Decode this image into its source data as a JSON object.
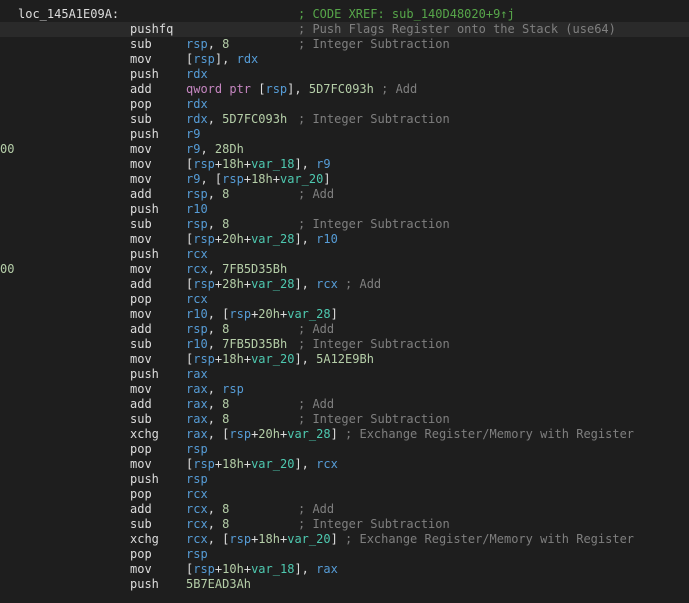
{
  "colors": {
    "background": "#1e1e1e",
    "highlight_line": "#2a2a2a",
    "register": "#569cd6",
    "number": "#b5cea8",
    "variable": "#4ec9b0",
    "keyword": "#c586c0",
    "comment": "#7f7f7f",
    "xref": "#57a64a",
    "text": "#dcdcdc"
  },
  "label": "loc_145A1E09A:",
  "xref_comment": "; CODE XREF: sub_140D48020+9↑j",
  "instructions": [
    {
      "mn": "pushfq",
      "ops": [],
      "comment": "; Push Flags Register onto the Stack (use64)",
      "sel": true
    },
    {
      "mn": "sub",
      "ops": [
        [
          "rsp",
          "r"
        ],
        [
          ", ",
          "p"
        ],
        [
          "8",
          "n"
        ]
      ],
      "comment": "; Integer Subtraction"
    },
    {
      "mn": "mov",
      "ops": [
        [
          "[",
          "p"
        ],
        [
          "rsp",
          "r"
        ],
        [
          "], ",
          "p"
        ],
        [
          "rdx",
          "r"
        ]
      ]
    },
    {
      "mn": "push",
      "ops": [
        [
          "rdx",
          "r"
        ]
      ]
    },
    {
      "mn": "add",
      "ops": [
        [
          "qword ptr ",
          "k"
        ],
        [
          "[",
          "p"
        ],
        [
          "rsp",
          "r"
        ],
        [
          "], ",
          "p"
        ],
        [
          "5D7FC093h",
          "n"
        ],
        [
          " ; Add",
          "c"
        ]
      ]
    },
    {
      "mn": "pop",
      "ops": [
        [
          "rdx",
          "r"
        ]
      ]
    },
    {
      "mn": "sub",
      "ops": [
        [
          "rdx",
          "r"
        ],
        [
          ", ",
          "p"
        ],
        [
          "5D7FC093h",
          "n"
        ]
      ],
      "comment": "; Integer Subtraction"
    },
    {
      "mn": "push",
      "ops": [
        [
          "r9",
          "r"
        ]
      ]
    },
    {
      "prefix": "00",
      "mn": "mov",
      "ops": [
        [
          "r9",
          "r"
        ],
        [
          ", ",
          "p"
        ],
        [
          "28Dh",
          "n"
        ]
      ]
    },
    {
      "mn": "mov",
      "ops": [
        [
          "[",
          "p"
        ],
        [
          "rsp",
          "r"
        ],
        [
          "+",
          "p"
        ],
        [
          "18h",
          "n"
        ],
        [
          "+",
          "p"
        ],
        [
          "var_18",
          "v"
        ],
        [
          "], ",
          "p"
        ],
        [
          "r9",
          "r"
        ]
      ]
    },
    {
      "mn": "mov",
      "ops": [
        [
          "r9",
          "r"
        ],
        [
          ", [",
          "p"
        ],
        [
          "rsp",
          "r"
        ],
        [
          "+",
          "p"
        ],
        [
          "18h",
          "n"
        ],
        [
          "+",
          "p"
        ],
        [
          "var_20",
          "v"
        ],
        [
          "]",
          "p"
        ]
      ]
    },
    {
      "mn": "add",
      "ops": [
        [
          "rsp",
          "r"
        ],
        [
          ", ",
          "p"
        ],
        [
          "8",
          "n"
        ]
      ],
      "comment": "; Add"
    },
    {
      "mn": "push",
      "ops": [
        [
          "r10",
          "r"
        ]
      ]
    },
    {
      "mn": "sub",
      "ops": [
        [
          "rsp",
          "r"
        ],
        [
          ", ",
          "p"
        ],
        [
          "8",
          "n"
        ]
      ],
      "comment": "; Integer Subtraction"
    },
    {
      "mn": "mov",
      "ops": [
        [
          "[",
          "p"
        ],
        [
          "rsp",
          "r"
        ],
        [
          "+",
          "p"
        ],
        [
          "20h",
          "n"
        ],
        [
          "+",
          "p"
        ],
        [
          "var_28",
          "v"
        ],
        [
          "], ",
          "p"
        ],
        [
          "r10",
          "r"
        ]
      ]
    },
    {
      "mn": "push",
      "ops": [
        [
          "rcx",
          "r"
        ]
      ]
    },
    {
      "prefix": "00",
      "mn": "mov",
      "ops": [
        [
          "rcx",
          "r"
        ],
        [
          ", ",
          "p"
        ],
        [
          "7FB5D35Bh",
          "n"
        ]
      ]
    },
    {
      "mn": "add",
      "ops": [
        [
          "[",
          "p"
        ],
        [
          "rsp",
          "r"
        ],
        [
          "+",
          "p"
        ],
        [
          "28h",
          "n"
        ],
        [
          "+",
          "p"
        ],
        [
          "var_28",
          "v"
        ],
        [
          "], ",
          "p"
        ],
        [
          "rcx",
          "r"
        ],
        [
          " ; Add",
          "c"
        ]
      ]
    },
    {
      "mn": "pop",
      "ops": [
        [
          "rcx",
          "r"
        ]
      ]
    },
    {
      "mn": "mov",
      "ops": [
        [
          "r10",
          "r"
        ],
        [
          ", [",
          "p"
        ],
        [
          "rsp",
          "r"
        ],
        [
          "+",
          "p"
        ],
        [
          "20h",
          "n"
        ],
        [
          "+",
          "p"
        ],
        [
          "var_28",
          "v"
        ],
        [
          "]",
          "p"
        ]
      ]
    },
    {
      "mn": "add",
      "ops": [
        [
          "rsp",
          "r"
        ],
        [
          ", ",
          "p"
        ],
        [
          "8",
          "n"
        ]
      ],
      "comment": "; Add"
    },
    {
      "mn": "sub",
      "ops": [
        [
          "r10",
          "r"
        ],
        [
          ", ",
          "p"
        ],
        [
          "7FB5D35Bh",
          "n"
        ]
      ],
      "comment": "; Integer Subtraction"
    },
    {
      "mn": "mov",
      "ops": [
        [
          "[",
          "p"
        ],
        [
          "rsp",
          "r"
        ],
        [
          "+",
          "p"
        ],
        [
          "18h",
          "n"
        ],
        [
          "+",
          "p"
        ],
        [
          "var_20",
          "v"
        ],
        [
          "], ",
          "p"
        ],
        [
          "5A12E9Bh",
          "n"
        ]
      ]
    },
    {
      "mn": "push",
      "ops": [
        [
          "rax",
          "r"
        ]
      ]
    },
    {
      "mn": "mov",
      "ops": [
        [
          "rax",
          "r"
        ],
        [
          ", ",
          "p"
        ],
        [
          "rsp",
          "r"
        ]
      ]
    },
    {
      "mn": "add",
      "ops": [
        [
          "rax",
          "r"
        ],
        [
          ", ",
          "p"
        ],
        [
          "8",
          "n"
        ]
      ],
      "comment": "; Add"
    },
    {
      "mn": "sub",
      "ops": [
        [
          "rax",
          "r"
        ],
        [
          ", ",
          "p"
        ],
        [
          "8",
          "n"
        ]
      ],
      "comment": "; Integer Subtraction"
    },
    {
      "mn": "xchg",
      "ops": [
        [
          "rax",
          "r"
        ],
        [
          ", [",
          "p"
        ],
        [
          "rsp",
          "r"
        ],
        [
          "+",
          "p"
        ],
        [
          "20h",
          "n"
        ],
        [
          "+",
          "p"
        ],
        [
          "var_28",
          "v"
        ],
        [
          "]",
          "p"
        ],
        [
          " ; Exchange Register/Memory with Register",
          "c"
        ]
      ]
    },
    {
      "mn": "pop",
      "ops": [
        [
          "rsp",
          "r"
        ]
      ]
    },
    {
      "mn": "mov",
      "ops": [
        [
          "[",
          "p"
        ],
        [
          "rsp",
          "r"
        ],
        [
          "+",
          "p"
        ],
        [
          "18h",
          "n"
        ],
        [
          "+",
          "p"
        ],
        [
          "var_20",
          "v"
        ],
        [
          "], ",
          "p"
        ],
        [
          "rcx",
          "r"
        ]
      ]
    },
    {
      "mn": "push",
      "ops": [
        [
          "rsp",
          "r"
        ]
      ]
    },
    {
      "mn": "pop",
      "ops": [
        [
          "rcx",
          "r"
        ]
      ]
    },
    {
      "mn": "add",
      "ops": [
        [
          "rcx",
          "r"
        ],
        [
          ", ",
          "p"
        ],
        [
          "8",
          "n"
        ]
      ],
      "comment": "; Add"
    },
    {
      "mn": "sub",
      "ops": [
        [
          "rcx",
          "r"
        ],
        [
          ", ",
          "p"
        ],
        [
          "8",
          "n"
        ]
      ],
      "comment": "; Integer Subtraction"
    },
    {
      "mn": "xchg",
      "ops": [
        [
          "rcx",
          "r"
        ],
        [
          ", [",
          "p"
        ],
        [
          "rsp",
          "r"
        ],
        [
          "+",
          "p"
        ],
        [
          "18h",
          "n"
        ],
        [
          "+",
          "p"
        ],
        [
          "var_20",
          "v"
        ],
        [
          "]",
          "p"
        ],
        [
          " ; Exchange Register/Memory with Register",
          "c"
        ]
      ]
    },
    {
      "mn": "pop",
      "ops": [
        [
          "rsp",
          "r"
        ]
      ]
    },
    {
      "mn": "mov",
      "ops": [
        [
          "[",
          "p"
        ],
        [
          "rsp",
          "r"
        ],
        [
          "+",
          "p"
        ],
        [
          "10h",
          "n"
        ],
        [
          "+",
          "p"
        ],
        [
          "var_18",
          "v"
        ],
        [
          "], ",
          "p"
        ],
        [
          "rax",
          "r"
        ]
      ]
    },
    {
      "mn": "push",
      "ops": [
        [
          "5B7EAD3Ah",
          "n"
        ]
      ]
    }
  ]
}
